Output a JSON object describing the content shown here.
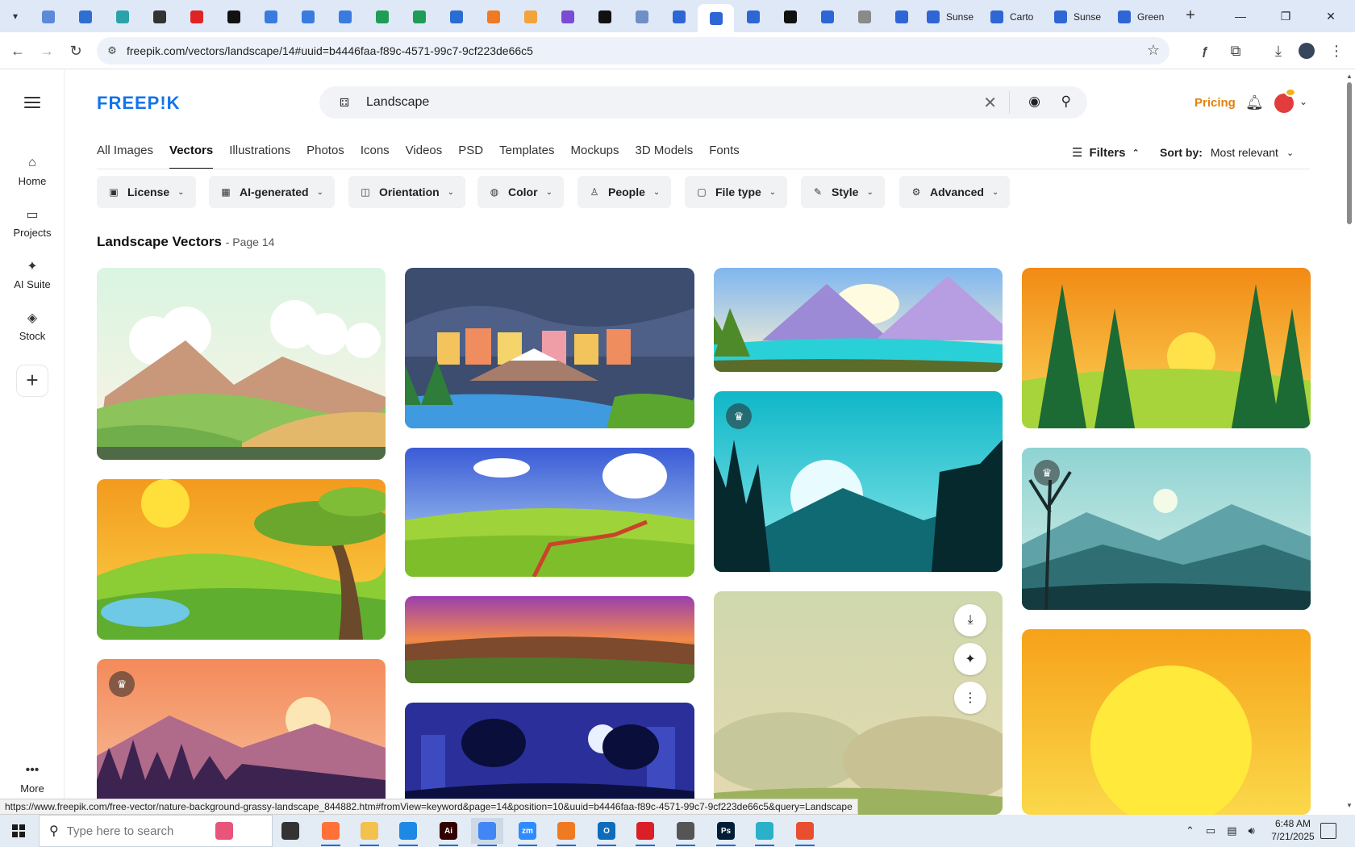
{
  "browser": {
    "url": "freepik.com/vectors/landscape/14#uuid=b4446faa-f89c-4571-99c7-9cf223de66c5",
    "tabs": [
      {
        "icon": "globe-icon",
        "color": "#5b8bd8",
        "title": ""
      },
      {
        "icon": "shield-icon",
        "color": "#2f6fd2",
        "title": ""
      },
      {
        "icon": "play-icon",
        "color": "#2aa3a8",
        "title": ""
      },
      {
        "icon": "openai-icon",
        "color": "#333333",
        "title": ""
      },
      {
        "icon": "youtube-icon",
        "color": "#e02424",
        "title": ""
      },
      {
        "icon": "bolt-icon",
        "color": "#111111",
        "title": ""
      },
      {
        "icon": "docs-icon",
        "color": "#3a7be0",
        "title": ""
      },
      {
        "icon": "docs-icon",
        "color": "#3a7be0",
        "title": ""
      },
      {
        "icon": "docs-icon",
        "color": "#3a7be0",
        "title": ""
      },
      {
        "icon": "sheets-icon",
        "color": "#1f9d55",
        "title": ""
      },
      {
        "icon": "sheets-icon",
        "color": "#1f9d55",
        "title": ""
      },
      {
        "icon": "word-icon",
        "color": "#2b6cd1",
        "title": ""
      },
      {
        "icon": "xampp-icon",
        "color": "#f07a22",
        "title": ""
      },
      {
        "icon": "flame-icon",
        "color": "#f2a33a",
        "title": ""
      },
      {
        "icon": "braces-icon",
        "color": "#7b4bd6",
        "title": ""
      },
      {
        "icon": "lambda-icon",
        "color": "#111111",
        "title": ""
      },
      {
        "icon": "db-icon",
        "color": "#6f8fc7",
        "title": ""
      },
      {
        "icon": "forms-icon",
        "color": "#2f66d6",
        "title": ""
      },
      {
        "icon": "forms-icon",
        "color": "#2f66d6",
        "title": "",
        "active": true
      },
      {
        "icon": "forms-icon",
        "color": "#2f66d6",
        "title": ""
      },
      {
        "icon": "m-icon",
        "color": "#111111",
        "title": ""
      },
      {
        "icon": "forms-icon",
        "color": "#2f66d6",
        "title": ""
      },
      {
        "icon": "globe-gray-icon",
        "color": "#8a8a8a",
        "title": ""
      },
      {
        "icon": "forms-icon",
        "color": "#2f66d6",
        "title": ""
      },
      {
        "icon": "forms-icon",
        "color": "#2f66d6",
        "title": "Sunse"
      },
      {
        "icon": "forms-icon",
        "color": "#2f66d6",
        "title": "Carto"
      },
      {
        "icon": "forms-icon",
        "color": "#2f66d6",
        "title": "Sunse"
      },
      {
        "icon": "forms-icon",
        "color": "#2f66d6",
        "title": "Green"
      }
    ]
  },
  "sidebar": {
    "items": [
      {
        "label": "Home",
        "icon": "home-icon"
      },
      {
        "label": "Projects",
        "icon": "folder-icon"
      },
      {
        "label": "AI Suite",
        "icon": "sparkle-icon"
      },
      {
        "label": "Stock",
        "icon": "stock-icon"
      }
    ],
    "more_label": "More"
  },
  "header": {
    "logo": "FREEP!K",
    "search_value": "Landscape",
    "pricing_label": "Pricing"
  },
  "type_tabs": [
    "All Images",
    "Vectors",
    "Illustrations",
    "Photos",
    "Icons",
    "Videos",
    "PSD",
    "Templates",
    "Mockups",
    "3D Models",
    "Fonts"
  ],
  "active_type_tab": "Vectors",
  "filters_label": "Filters",
  "sort": {
    "label": "Sort by:",
    "value": "Most relevant"
  },
  "filter_pills": [
    {
      "label": "License",
      "icon": "license-icon"
    },
    {
      "label": "AI-generated",
      "icon": "ai-icon"
    },
    {
      "label": "Orientation",
      "icon": "orientation-icon"
    },
    {
      "label": "Color",
      "icon": "palette-icon"
    },
    {
      "label": "People",
      "icon": "people-icon"
    },
    {
      "label": "File type",
      "icon": "file-icon"
    },
    {
      "label": "Style",
      "icon": "brush-icon"
    },
    {
      "label": "Advanced",
      "icon": "gear-icon"
    }
  ],
  "results": {
    "title": "Landscape Vectors",
    "page": "- Page 14"
  },
  "status_url": "https://www.freepik.com/free-vector/nature-background-grassy-landscape_844882.htm#fromView=keyword&page=14&position=10&uuid=b4446faa-f89c-4571-99c7-9cf223de66c5&query=Landscape",
  "taskbar": {
    "search_placeholder": "Type here to search",
    "time": "6:48 AM",
    "date": "7/21/2025",
    "apps": [
      {
        "icon": "balloons-icon",
        "color": "#e8557a"
      },
      {
        "icon": "task-view-icon",
        "color": "#333333"
      },
      {
        "icon": "firefox-icon",
        "color": "#ff7139"
      },
      {
        "icon": "file-explorer-icon",
        "color": "#f2c14e"
      },
      {
        "icon": "vscode-icon",
        "color": "#1e88e5"
      },
      {
        "icon": "illustrator-icon",
        "color": "#330000"
      },
      {
        "icon": "chrome-icon",
        "color": "#4285f4"
      },
      {
        "icon": "zoom-icon",
        "color": "#2d8cff"
      },
      {
        "icon": "xampp-icon",
        "color": "#f07a22"
      },
      {
        "icon": "outlook-icon",
        "color": "#0f6cbd"
      },
      {
        "icon": "creative-cloud-icon",
        "color": "#da1f26"
      },
      {
        "icon": "pen-icon",
        "color": "#555555"
      },
      {
        "icon": "photoshop-icon",
        "color": "#001e36"
      },
      {
        "icon": "cube-icon",
        "color": "#2ab0c9"
      },
      {
        "icon": "git-icon",
        "color": "#e94e31"
      }
    ]
  },
  "grid_badges": {
    "premium": "premium-crown-icon"
  }
}
